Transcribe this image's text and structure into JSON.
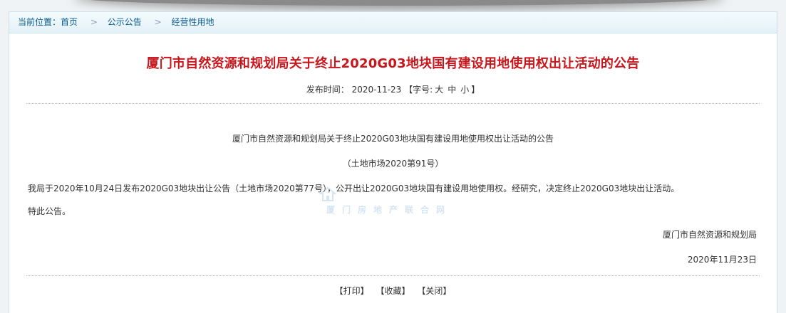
{
  "breadcrumb": {
    "prefix": "当前位置：",
    "items": [
      "首页",
      "公示公告",
      "经营性用地"
    ]
  },
  "article": {
    "title": "厦门市自然资源和规划局关于终止2020G03地块国有建设用地使用权出让活动的公告",
    "publish_label": "发布时间：",
    "publish_date": "2020-11-23",
    "font_size_label": "【字号:",
    "font_sizes": [
      "大",
      "中",
      "小"
    ],
    "font_size_close": "】",
    "doc_title": "厦门市自然资源和规划局关于终止2020G03地块国有建设用地使用权出让活动的公告",
    "doc_no": "（土地市场2020第91号）",
    "paragraph1": "我局于2020年10月24日发布2020G03地块出让公告（土地市场2020第77号），公开出让2020G03地块国有建设用地使用权。经研究，决定终止2020G03地块出让活动。",
    "paragraph2": "特此公告。",
    "signature": "厦门市自然资源和规划局",
    "sign_date": "2020年11月23日"
  },
  "watermark": {
    "text": "厦门房地产联合网"
  },
  "actions": {
    "print": "【打印】",
    "favorite": "【收藏】",
    "close": "【关闭】"
  }
}
